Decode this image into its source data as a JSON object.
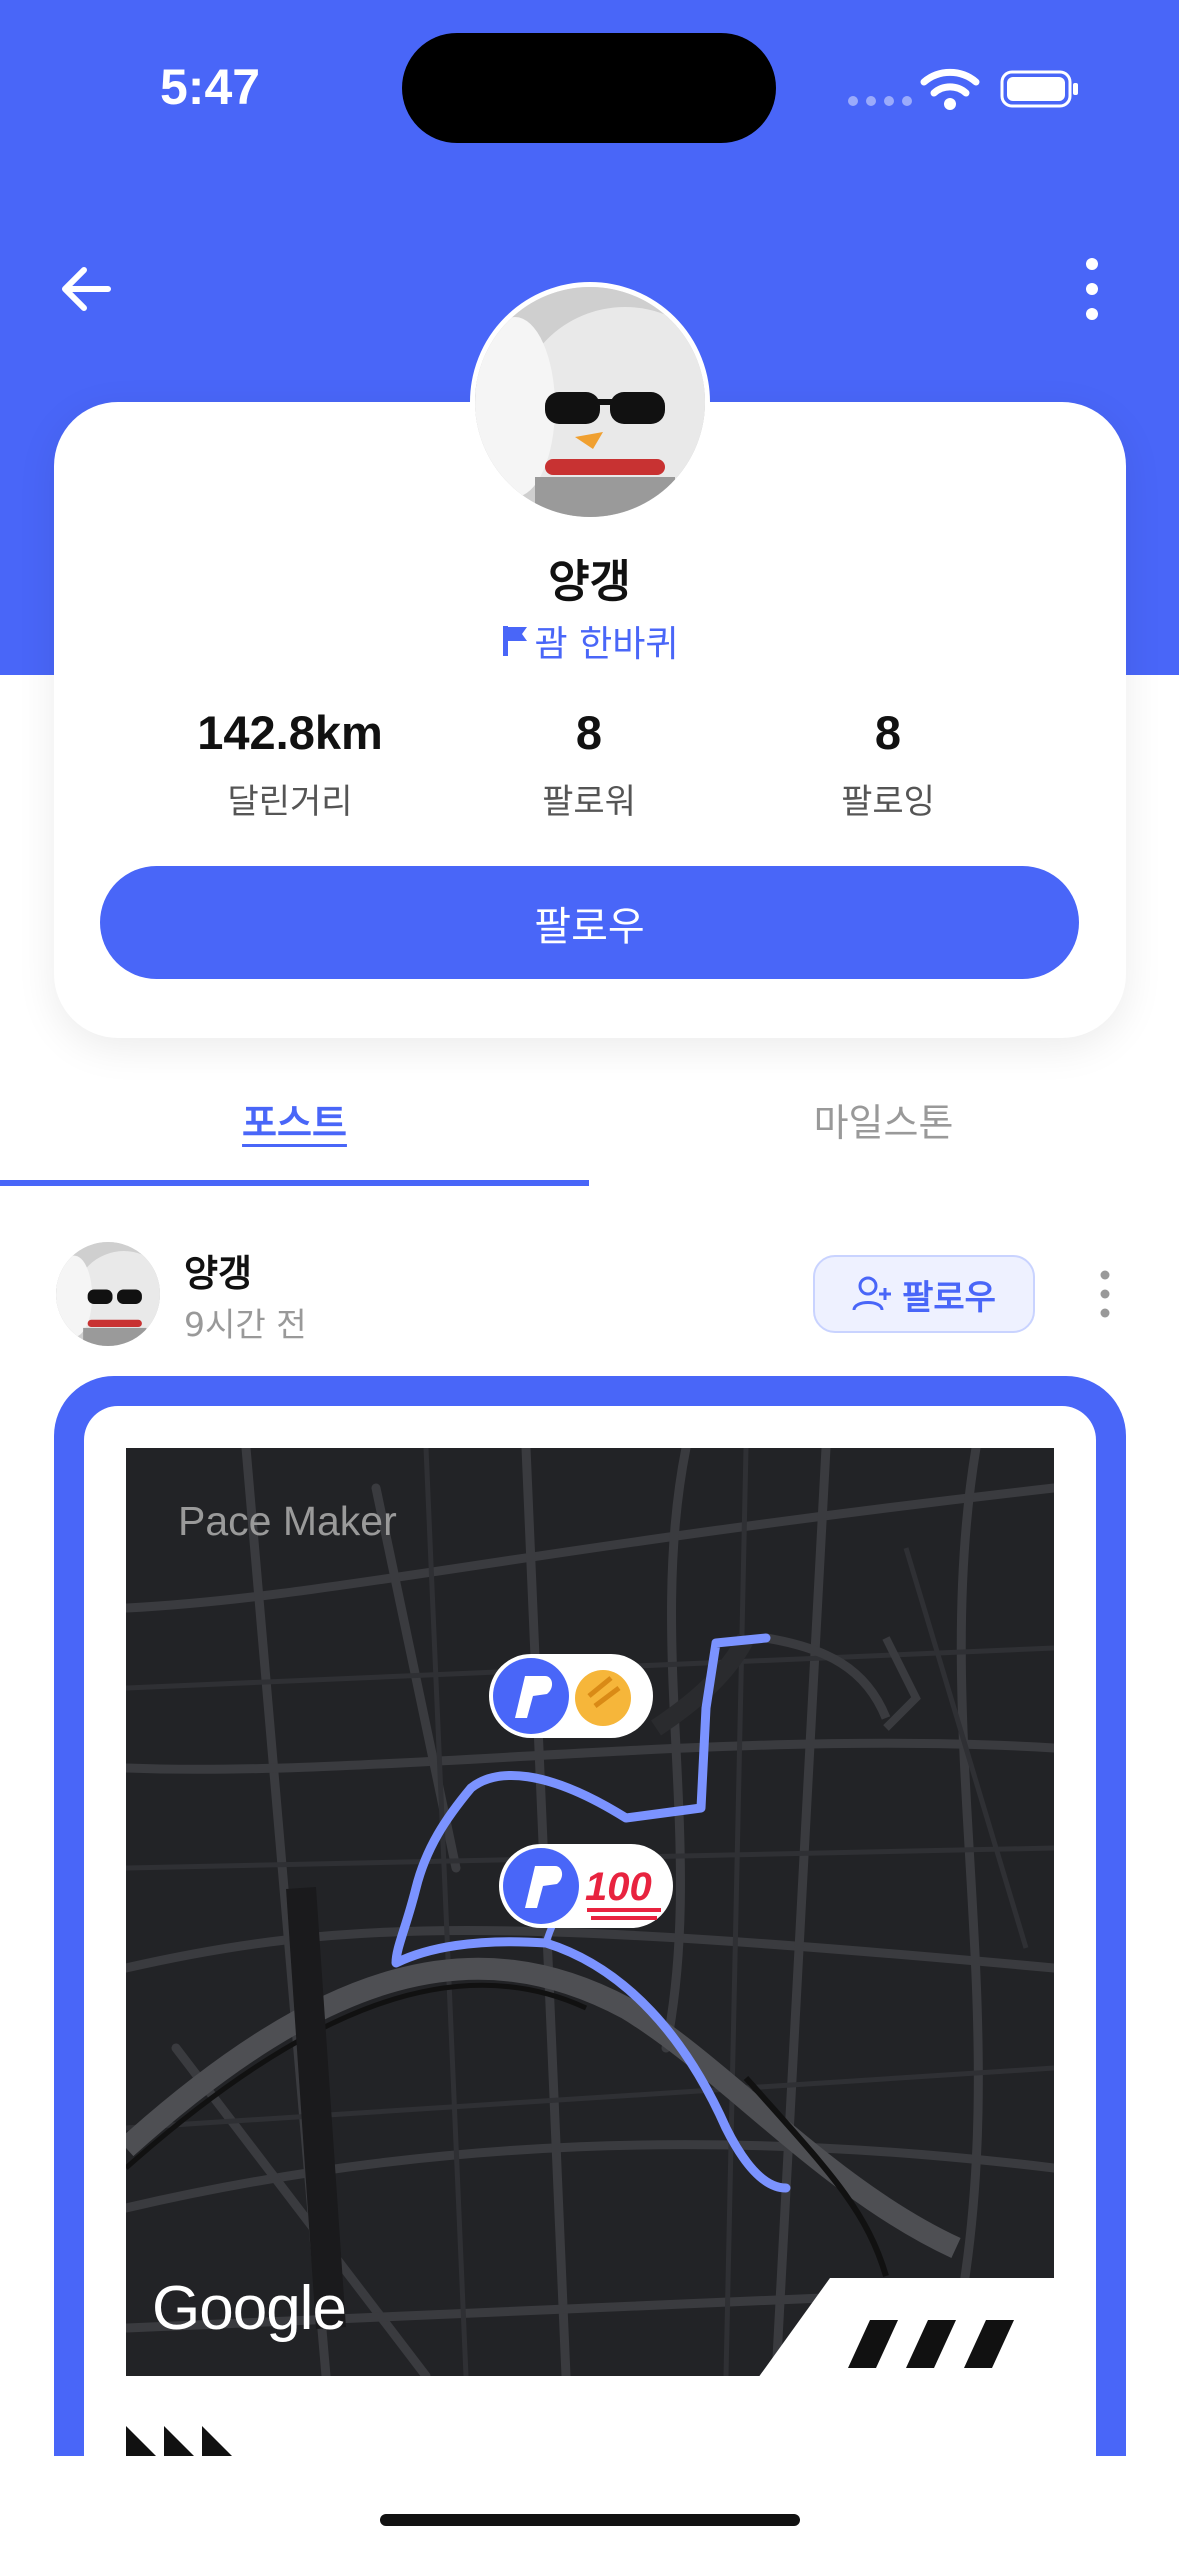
{
  "status_bar": {
    "time": "5:47"
  },
  "profile": {
    "name": "양갱",
    "crew": "괌 한바퀴",
    "stats": [
      {
        "value": "142.8km",
        "label": "달린거리"
      },
      {
        "value": "8",
        "label": "팔로워"
      },
      {
        "value": "8",
        "label": "팔로잉"
      }
    ],
    "follow_label": "팔로우"
  },
  "tabs": [
    {
      "label": "포스트",
      "active": true
    },
    {
      "label": "마일스톤",
      "active": false
    }
  ],
  "post": {
    "author": "양갱",
    "time": "9시간 전",
    "follow_label": "팔로우",
    "map": {
      "watermark": "Pace Maker",
      "attribution": "Google",
      "reactions": [
        "clap-emoji",
        "hundred-points-emoji"
      ]
    }
  },
  "colors": {
    "accent": "#4966F8",
    "map_bg": "#222326",
    "route": "#7B93FF"
  }
}
